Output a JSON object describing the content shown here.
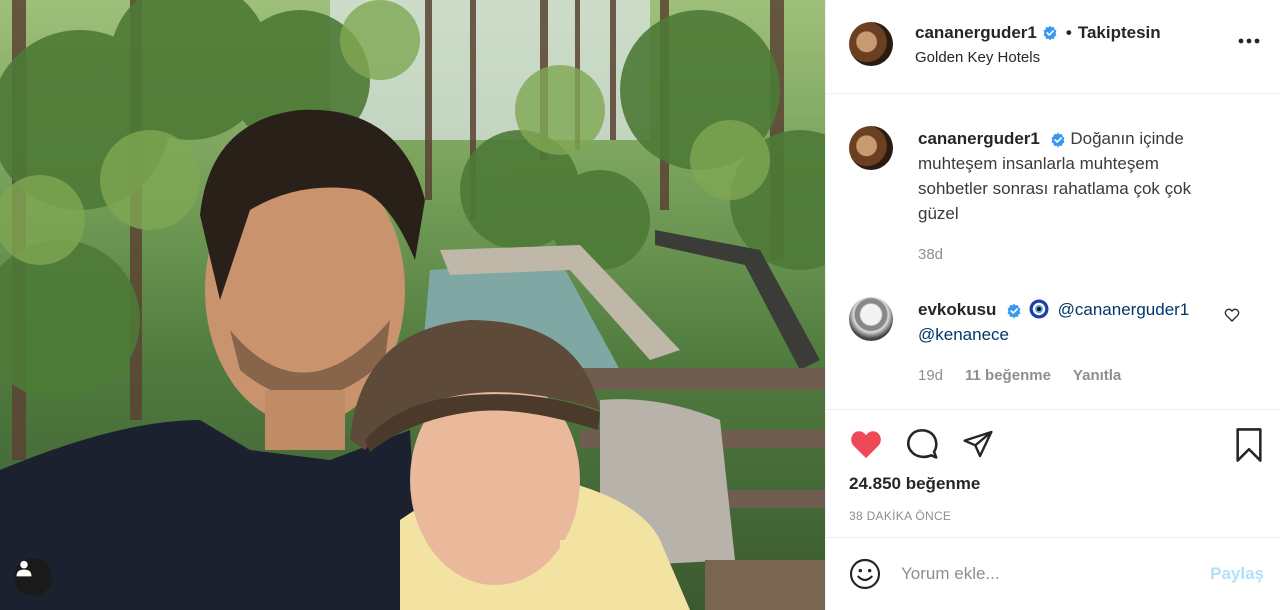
{
  "post": {
    "username": "cananerguder1",
    "dot": "•",
    "follow_state": "Takiptesin",
    "location": "Golden Key Hotels"
  },
  "caption": {
    "username": "cananerguder1",
    "text": "Doğanın içinde muhteşem insanlarla muhteşem sohbetler sonrası rahatlama çok çok güzel",
    "age": "38d"
  },
  "comment": {
    "username": "evkokusu",
    "mention1": "@cananerguder1",
    "mention2": "@kenanece",
    "age": "19d",
    "likes": "11 beğenme",
    "reply": "Yanıtla"
  },
  "actions": {
    "likes": "24.850 beğenme",
    "time": "38 DAKİKA ÖNCE"
  },
  "add_comment": {
    "placeholder": "Yorum ekle...",
    "post_label": "Paylaş"
  },
  "colors": {
    "like_red": "#ed4956",
    "verified_blue": "#3897f0",
    "link_blue": "#00376b",
    "post_disabled": "#b2dffc"
  },
  "icons": [
    "more-options-icon",
    "verified-badge-icon",
    "evil-eye-icon",
    "comment-heart-icon",
    "like-heart-icon",
    "comment-icon",
    "share-icon",
    "bookmark-icon",
    "emoji-icon",
    "user-tag-icon"
  ]
}
